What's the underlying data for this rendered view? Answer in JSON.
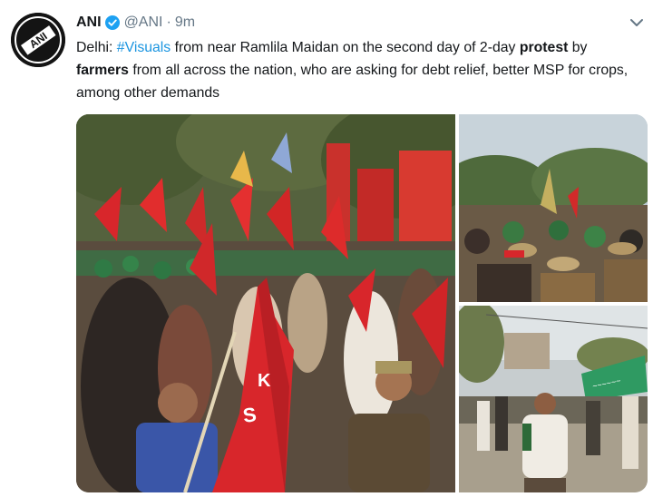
{
  "tweet": {
    "author_name": "ANI",
    "handle": "@ANI",
    "separator": "·",
    "time": "9m",
    "text": {
      "part1": "Delhi: ",
      "hashtag": "#Visuals",
      "part2": " from near Ramlila Maidan on the second day of 2-day ",
      "bold1": "protest",
      "part3": " by ",
      "bold2": "farmers",
      "part4": " from all across the nation, who are asking for debt relief, better MSP for crops, among other demands"
    }
  },
  "icons": {
    "avatar": "ani-logo",
    "verified": "verified-badge-icon",
    "more": "chevron-down-icon"
  },
  "colors": {
    "link": "#1b95e0",
    "secondary_text": "#657786",
    "verified_blue": "#1da1f2",
    "flag_red": "#d8262b"
  }
}
